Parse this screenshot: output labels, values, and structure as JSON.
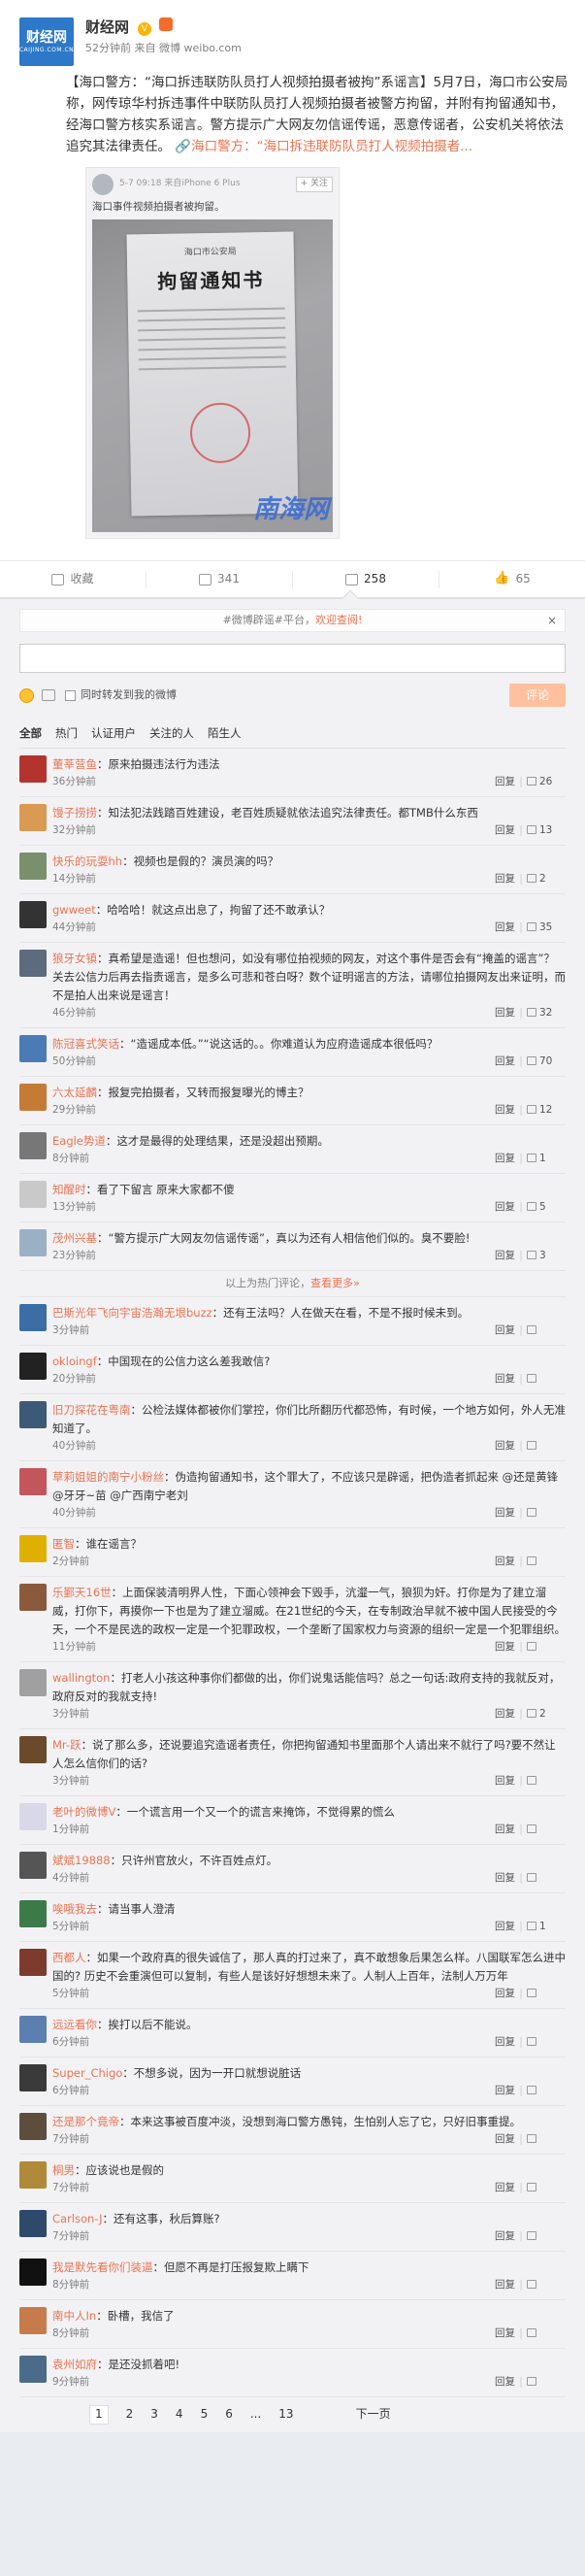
{
  "post": {
    "author": "财经网",
    "avatar_text": "财经网",
    "avatar_sub": "CAIJING.COM.CN",
    "meta_time": "52分钟前",
    "meta_source": "来自 微博 weibo.com",
    "text": "【海口警方：“海口拆违联防队员打人视频拍摄者被拘”系谣言】5月7日，海口市公安局称，网传琼华村拆违事件中联防队员打人视频拍摄者被警方拘留，并附有拘留通知书，经海口警方核实系谣言。警方提示广大网友勿信谣传谣，恶意传谣者，公安机关将依法追究其法律责任。",
    "link_text": "海口警方：“海口拆违联防队员打人视频拍摄者...",
    "embed": {
      "meta": "5-7 09:18 来自iPhone 6 Plus",
      "follow": "+ 关注",
      "text": "海口事件视频拍摄者被拘留。",
      "paper_head": "海口市公安局",
      "paper_title": "拘留通知书",
      "watermark": "南海网"
    },
    "actions": {
      "collect": "收藏",
      "repost": "341",
      "comment": "258",
      "like": "65"
    }
  },
  "composer": {
    "notice_tag": "#微博辟谣#平台，",
    "notice_link": "欢迎查阅!",
    "close": "×",
    "sync_label": "同时转发到我的微博",
    "submit": "评论"
  },
  "filters": [
    "全部",
    "热门",
    "认证用户",
    "关注的人",
    "陌生人"
  ],
  "reply_label": "回复",
  "more_hot": "以上为热门评论，",
  "more_hot_link": "查看更多»",
  "comments": [
    {
      "name": "董莘营鱼",
      "text": "原来拍摄违法行为违法",
      "time": "36分钟前",
      "likes": "26",
      "color": "#b3342c"
    },
    {
      "name": "馒子捞捞",
      "text": "知法犯法践踏百姓建设，老百姓质疑就依法追究法律责任。都TMB什么东西",
      "time": "32分钟前",
      "likes": "13",
      "color": "#d99a54"
    },
    {
      "name": "快乐的玩耍hh",
      "text": "视频也是假的？演员演的吗？",
      "time": "14分钟前",
      "likes": "2",
      "color": "#7a8f6b"
    },
    {
      "name": "gwweet",
      "text": "哈哈哈！就这点出息了，拘留了还不敢承认？",
      "time": "44分钟前",
      "likes": "35",
      "color": "#333333"
    },
    {
      "name": "狼牙女镇",
      "text": "真希望是造谣！但也想问，如没有哪位拍视频的网友，对这个事件是否会有“掩盖的谣言”？关去公信力后再去指责谣言，是多么可悲和苍白呀？数个证明谣言的方法，请哪位拍摄网友出来证明，而不是拍人出来说是谣言！",
      "time": "46分钟前",
      "likes": "32",
      "color": "#5c6b7e"
    },
    {
      "name": "陈冠喜式笑话",
      "text": "“造谣成本低。”“说这话的。。你难道认为应府造谣成本很低吗？",
      "time": "50分钟前",
      "likes": "70",
      "color": "#4a7bb7"
    },
    {
      "name": "六太延麟",
      "text": "报复完拍摄者，又转而报复曝光的博主？",
      "time": "29分钟前",
      "likes": "12",
      "color": "#c47b36"
    },
    {
      "name": "Eagle势道",
      "text": "这才是最得的处理结果，还是没超出预期。",
      "time": "8分钟前",
      "likes": "1",
      "color": "#777777"
    },
    {
      "name": "知醒时",
      "text": "看了下留言 原来大家都不傻",
      "time": "13分钟前",
      "likes": "5",
      "color": "#c9c9c9"
    },
    {
      "name": "茂州兴基",
      "text": "“警方提示广大网友勿信谣传谣”，真以为还有人相信他们似的。臭不要脸!",
      "time": "23分钟前",
      "likes": "3",
      "color": "#9ab0c4"
    },
    {
      "name": "巴斯光年飞向宇宙浩瀚无垠buzz",
      "text": "还有王法吗？人在做天在看，不是不报时候未到。",
      "time": "3分钟前",
      "likes": "",
      "color": "#3a6ea5"
    },
    {
      "name": "okloingf",
      "text": "中国现在的公信力这么差我敢信?",
      "time": "20分钟前",
      "likes": "",
      "color": "#222222"
    },
    {
      "name": "旧刀探花在粤南",
      "text": "公检法媒体都被你们掌控，你们比所翻历代都恐怖，有时候，一个地方如何，外人无准知道了。",
      "time": "40分钟前",
      "likes": "",
      "color": "#3c5a78"
    },
    {
      "name": "草莉姐姐的南宁小粉丝",
      "text": "伪造拘留通知书，这个罪大了，不应该只是辟谣，把伪造者抓起来 @还是黄锋 @牙牙~苗 @广西南宁老刘",
      "time": "40分钟前",
      "likes": "",
      "color": "#c2565b"
    },
    {
      "name": "匿智",
      "text": "谁在谣言？",
      "time": "2分钟前",
      "likes": "",
      "color": "#e0b000"
    },
    {
      "name": "乐鄞天16世",
      "text": "上面保装清明界人性，下面心领神会下毁手，沆瀣一气，狼狈为奸。打你是为了建立溜威，打你下，再摸你一下也是为了建立溜威。在21世纪的今天，在专制政治早就不被中国人民接受的今天，一个不是民选的政权一定是一个犯罪政权，一个垄断了国家权力与资源的组织一定是一个犯罪组织。",
      "time": "11分钟前",
      "likes": "",
      "color": "#8a5a3c"
    },
    {
      "name": "wallington",
      "text": "打老人小孩这种事你们都做的出，你们说鬼话能信吗？总之一句话:政府支持的我就反对，政府反对的我就支持!",
      "time": "3分钟前",
      "likes": "2",
      "color": "#a0a0a0"
    },
    {
      "name": "Mr-跃",
      "text": "说了那么多，还说要追究造谣者责任，你把拘留通知书里面那个人请出来不就行了吗?要不然让人怎么信你们的话?",
      "time": "3分钟前",
      "likes": "",
      "color": "#6b4a2c"
    },
    {
      "name": "老叶的微博V",
      "text": "一个谎言用一个又一个的谎言来掩饰，不觉得累的慌么",
      "time": "1分钟前",
      "likes": "",
      "color": "#d8d8e8"
    },
    {
      "name": "斌斌19888",
      "text": "只许州官放火，不许百姓点灯。",
      "time": "4分钟前",
      "likes": "",
      "color": "#555555"
    },
    {
      "name": "唉哦我去",
      "text": "请当事人澄清",
      "time": "5分钟前",
      "likes": "1",
      "color": "#3d7a4a"
    },
    {
      "name": "西都人",
      "text": "如果一个政府真的很失诚信了，那人真的打过来了，真不敢想象后果怎么样。八国联军怎么进中国的? 历史不会重演但可以复制，有些人是该好好想想未来了。人制人上百年，法制人万万年",
      "time": "5分钟前",
      "likes": "",
      "color": "#7c3b2c"
    },
    {
      "name": "远远看你",
      "text": "挨打以后不能说。",
      "time": "6分钟前",
      "likes": "",
      "color": "#5a7fb0"
    },
    {
      "name": "Super_Chigo",
      "text": "不想多说，因为一开口就想说脏话",
      "time": "6分钟前",
      "likes": "",
      "color": "#3a3a3a"
    },
    {
      "name": "还是那个竟帝",
      "text": "本来这事被百度冲淡，没想到海口警方愚钝，生怕别人忘了它，只好旧事重提。",
      "time": "7分钟前",
      "likes": "",
      "color": "#5c4d3d"
    },
    {
      "name": "桐男",
      "text": "应该说也是假的",
      "time": "7分钟前",
      "likes": "",
      "color": "#b08a3a"
    },
    {
      "name": "Carlson-J",
      "text": "还有这事，秋后算账?",
      "time": "7分钟前",
      "likes": "",
      "color": "#2d4a6b"
    },
    {
      "name": "我是默先看你们装逼",
      "text": "但愿不再是打压报复欺上瞒下",
      "time": "8分钟前",
      "likes": "",
      "color": "#111111"
    },
    {
      "name": "南中人In",
      "text": "卧槽，我信了",
      "time": "8分钟前",
      "likes": "",
      "color": "#c77b4a"
    },
    {
      "name": "袁州如府",
      "text": "是还没抓着吧!",
      "time": "9分钟前",
      "likes": "",
      "color": "#4a6b8a"
    }
  ],
  "pager": {
    "pages": [
      "1",
      "2",
      "3",
      "4",
      "5",
      "6",
      "...",
      "13"
    ],
    "current": "1",
    "next": "下一页"
  }
}
